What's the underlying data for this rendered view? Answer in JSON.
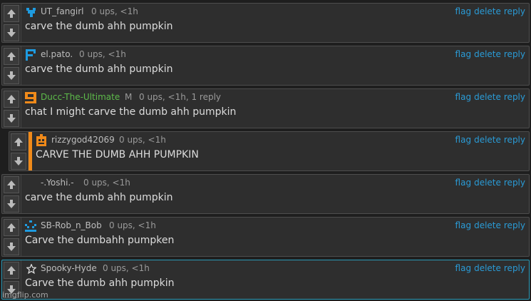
{
  "actions": {
    "flag": "flag",
    "delete": "delete",
    "reply": "reply"
  },
  "comments": [
    {
      "username": "UT_fangirl",
      "meta": "0 ups, <1h",
      "text": "carve the dumb ahh pumpkin",
      "avatar_icon": "blue-heart-pixel-icon"
    },
    {
      "username": "el.pato.",
      "meta": "0 ups, <1h",
      "text": "carve the dumb ahh pumpkin",
      "avatar_icon": "blue-f-pixel-icon"
    },
    {
      "username": "Ducc-The-Ultimate",
      "mod": "M",
      "meta": "0 ups, <1h, 1 reply",
      "text": "chat I might carve the dumb ahh pumpkin",
      "avatar_icon": "orange-9-pixel-icon"
    },
    {
      "username": "rizzygod42069",
      "meta": "0 ups, <1h",
      "text": "CARVE THE DUMB AHH PUMPKIN",
      "avatar_icon": "orange-pumpkin-pixel-icon"
    },
    {
      "username": "-.Yoshi.-",
      "meta": "0 ups, <1h",
      "text": "carve the dumb ahh pumpkin",
      "avatar_icon": ""
    },
    {
      "username": "SB-Rob_n_Bob",
      "meta": "0 ups, <1h",
      "text": "Carve the dumbahh pumpken",
      "avatar_icon": "blue-face-pixel-icon"
    },
    {
      "username": "Spooky-Hyde",
      "meta": "0 ups, <1h",
      "text": "Carve the dumb ahh pumpkin",
      "avatar_icon": "star-icon"
    }
  ],
  "watermark": "imgflip.com",
  "colors": {
    "accent_link": "#2a9bd6",
    "avatar_blue": "#1e9be0",
    "avatar_orange": "#f08a1a",
    "mod_green": "#5dbb4a"
  }
}
